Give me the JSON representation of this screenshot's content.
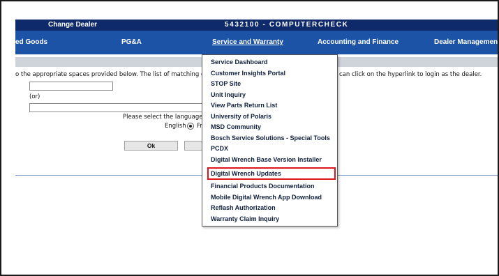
{
  "topbar": {
    "change_dealer": "Change Dealer",
    "dealer_id": "5432100 - COMPUTERCHECK"
  },
  "nav": {
    "items": [
      {
        "label": "ed Goods"
      },
      {
        "label": "PG&A"
      },
      {
        "label": "Service and Warranty"
      },
      {
        "label": "Accounting and Finance"
      },
      {
        "label": "Dealer Managemen"
      }
    ]
  },
  "main": {
    "instruction_left": "o the appropriate spaces provided below. The list of matching d",
    "instruction_right": "can click on the hyperlink to login as the dealer.",
    "or_label": "(or)",
    "language_prompt": "Please select the language l",
    "language_english": "English",
    "language_french": "Fren",
    "ok_label": "Ok"
  },
  "dropdown": {
    "items": [
      {
        "label": "Service Dashboard"
      },
      {
        "label": "Customer Insights Portal"
      },
      {
        "label": "STOP Site"
      },
      {
        "label": "Unit Inquiry"
      },
      {
        "label": "View Parts Return List"
      },
      {
        "label": "University of Polaris"
      },
      {
        "label": "MSD Community"
      },
      {
        "label": "Bosch Service Solutions - Special Tools"
      },
      {
        "label": "PCDX"
      },
      {
        "label": "Digital Wrench Base Version Installer"
      },
      {
        "label": "Digital Wrench Updates"
      },
      {
        "label": "Financial Products Documentation"
      },
      {
        "label": "Mobile Digital Wrench App Download"
      },
      {
        "label": "Reflash Authorization"
      },
      {
        "label": "Warranty Claim Inquiry"
      }
    ],
    "highlighted_item": "Digital Wrench Updates",
    "highlight_color": "#e0141b"
  },
  "colors": {
    "topbar": "#0e2a6b",
    "navbar": "#1d53a6",
    "strip": "#cfd3da"
  }
}
